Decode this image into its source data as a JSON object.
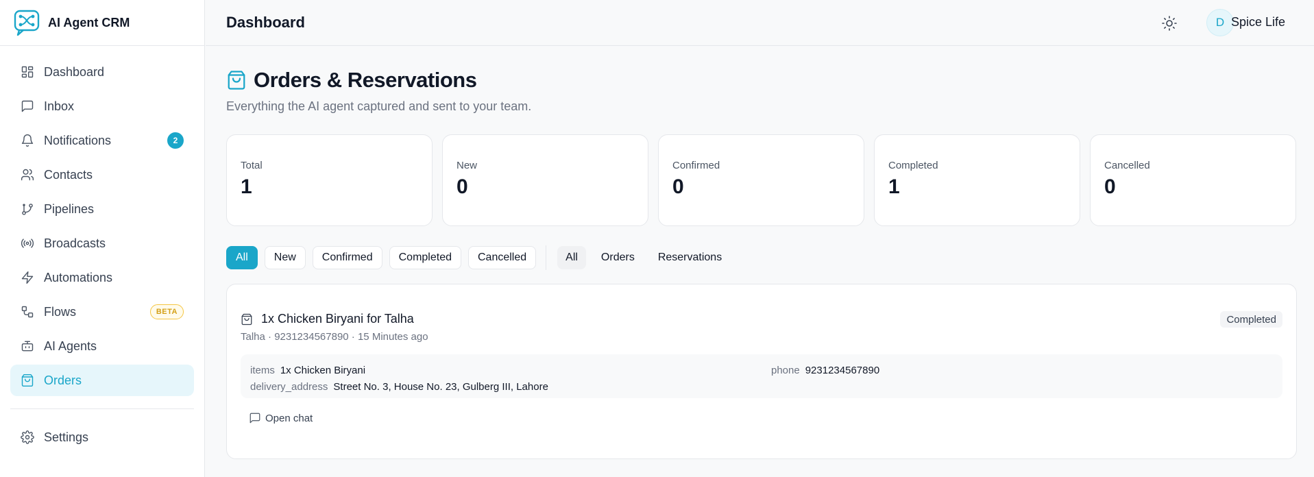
{
  "brand": {
    "name": "AI Agent CRM"
  },
  "sidebar": {
    "items": [
      {
        "label": "Dashboard",
        "icon": "dashboard-icon"
      },
      {
        "label": "Inbox",
        "icon": "message-icon"
      },
      {
        "label": "Notifications",
        "icon": "bell-icon",
        "badge": "2"
      },
      {
        "label": "Contacts",
        "icon": "users-icon"
      },
      {
        "label": "Pipelines",
        "icon": "git-branch-icon"
      },
      {
        "label": "Broadcasts",
        "icon": "radio-icon"
      },
      {
        "label": "Automations",
        "icon": "zap-icon"
      },
      {
        "label": "Flows",
        "icon": "workflow-icon",
        "tag": "BETA"
      },
      {
        "label": "AI Agents",
        "icon": "bot-icon"
      },
      {
        "label": "Orders",
        "icon": "shopping-bag-icon",
        "active": true
      }
    ],
    "footer": {
      "label": "Settings",
      "icon": "gear-icon"
    }
  },
  "header": {
    "title": "Dashboard",
    "avatar_initial": "D",
    "user_name": "Spice Life"
  },
  "page": {
    "title": "Orders & Reservations",
    "subtitle": "Everything the AI agent captured and sent to your team."
  },
  "stats": [
    {
      "label": "Total",
      "value": "1"
    },
    {
      "label": "New",
      "value": "0"
    },
    {
      "label": "Confirmed",
      "value": "0"
    },
    {
      "label": "Completed",
      "value": "1"
    },
    {
      "label": "Cancelled",
      "value": "0"
    }
  ],
  "status_filters": [
    "All",
    "New",
    "Confirmed",
    "Completed",
    "Cancelled"
  ],
  "type_filters": [
    "All",
    "Orders",
    "Reservations"
  ],
  "orders": [
    {
      "title": "1x Chicken Biryani for Talha",
      "status": "Completed",
      "customer": "Talha",
      "phone": "9231234567890",
      "time_ago": "15 Minutes ago",
      "meta": "Talha · 9231234567890 · 15 Minutes ago",
      "items_key": "items",
      "items_value": "1x Chicken Biryani",
      "phone_key": "phone",
      "phone_value": "9231234567890",
      "address_key": "delivery_address",
      "address_value": "Street No. 3, House No. 23, Gulberg III, Lahore",
      "open_chat_label": "Open chat"
    }
  ],
  "colors": {
    "accent": "#1aa6c9",
    "beta": "#d4a017"
  }
}
